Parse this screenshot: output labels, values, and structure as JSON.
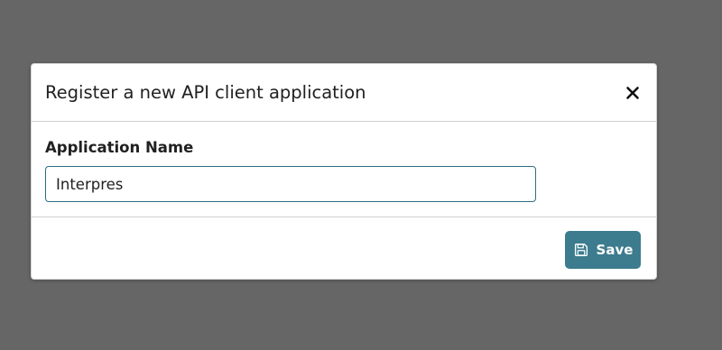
{
  "modal": {
    "title": "Register a new API client application",
    "close_icon": "close-icon"
  },
  "form": {
    "application_name_label": "Application Name",
    "application_name_value": "Interpres"
  },
  "footer": {
    "save_label": "Save",
    "save_icon": "floppy-disk-icon"
  },
  "colors": {
    "backdrop": "#666666",
    "accent": "#3c7c8e",
    "input_border": "#2f6e83"
  }
}
